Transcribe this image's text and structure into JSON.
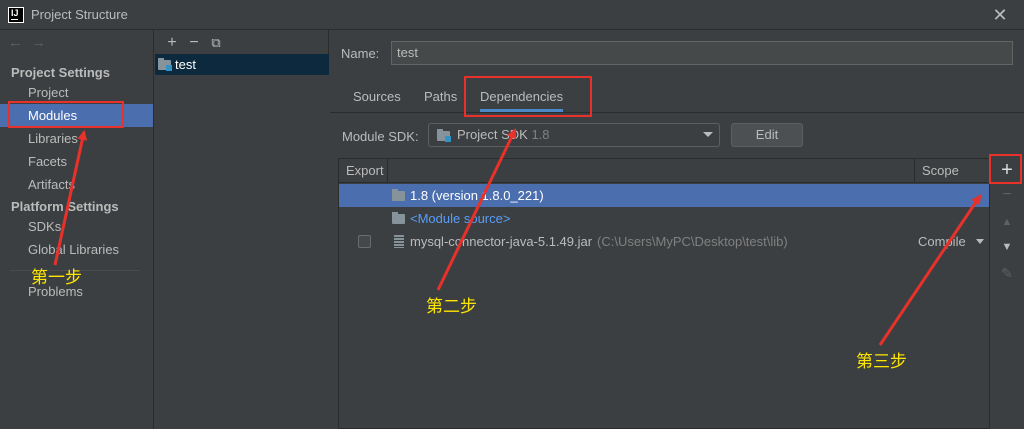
{
  "window": {
    "title": "Project Structure",
    "close_glyph": "✕",
    "app_icon_letters": "IJ"
  },
  "leftnav": {
    "back_glyph": "←",
    "forward_glyph": "→",
    "section_project": "Project Settings",
    "project_items": [
      "Project",
      "Modules",
      "Libraries",
      "Facets",
      "Artifacts"
    ],
    "section_platform": "Platform Settings",
    "platform_items": [
      "SDKs",
      "Global Libraries"
    ],
    "problems": "Problems",
    "selected": "Modules"
  },
  "modules": {
    "toolbar": {
      "add": "+",
      "remove": "−",
      "copy": "⧉"
    },
    "items": [
      "test"
    ]
  },
  "main": {
    "name_label": "Name:",
    "name_value": "test",
    "tabs": [
      "Sources",
      "Paths",
      "Dependencies"
    ],
    "active_tab": "Dependencies",
    "sdk_label": "Module SDK:",
    "sdk_value": "Project SDK",
    "sdk_version": "1.8",
    "edit_button": "Edit",
    "table": {
      "col_export": "Export",
      "col_scope": "Scope",
      "rows": [
        {
          "name": "1.8 (version 1.8.0_221)",
          "detail": "",
          "scope": "",
          "selected": true
        },
        {
          "name": "<Module source>",
          "detail": "",
          "scope": "",
          "selected": false
        },
        {
          "name": "mysql-connector-java-5.1.49.jar",
          "detail": "(C:\\Users\\MyPC\\Desktop\\test\\lib)",
          "scope": "Compile",
          "selected": false
        }
      ]
    }
  },
  "right_toolbar": {
    "add": "+",
    "remove": "−",
    "up": "▲",
    "down": "▼",
    "edit": "✎"
  },
  "annotations": {
    "step1": "第一步",
    "step2": "第二步",
    "step3": "第三步",
    "color": "#ffe600",
    "box_color": "#e8312a"
  }
}
